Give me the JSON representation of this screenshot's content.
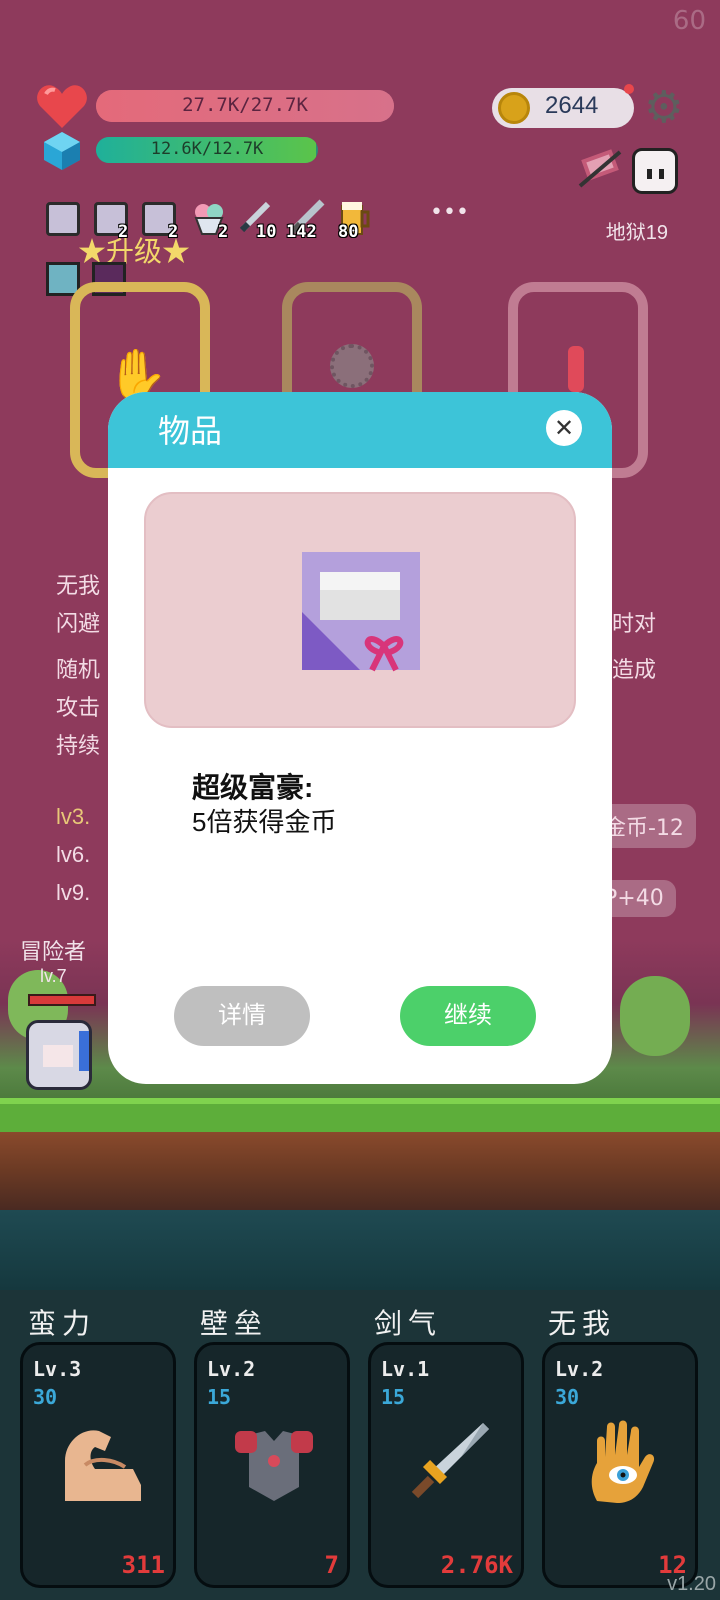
{
  "fps": "60",
  "hp": {
    "text": "27.7K/27.7K",
    "fill": 1.0
  },
  "mana": {
    "text": "12.6K/12.7K",
    "fill": 0.99
  },
  "coins": "2644",
  "stage": "地狱19",
  "buffs": [
    {
      "icon": "gift-scroll-icon",
      "count": ""
    },
    {
      "icon": "gift-scroll-icon",
      "count": "2"
    },
    {
      "icon": "gift-scroll-icon",
      "count": "2"
    },
    {
      "icon": "ice-cream-icon",
      "count": "2"
    },
    {
      "icon": "dagger-icon",
      "count": "10"
    },
    {
      "icon": "sword-icon",
      "count": "142"
    },
    {
      "icon": "beer-icon",
      "count": "80"
    }
  ],
  "more": "•••",
  "upgrade_banner": "★升级★",
  "background_text": {
    "line1": "无我",
    "line2_left": "闪避",
    "line2_right": "时对",
    "line3_left": "随机",
    "line3_right": "造成",
    "line4": "攻击",
    "line5": "持续",
    "lv3": "lv3.",
    "lv6": "lv6.",
    "lv9": "lv9.",
    "chip1": "金币-12",
    "chip2": "P+40"
  },
  "player": {
    "name": "冒险者",
    "level": "lv.7"
  },
  "modal": {
    "title": "物品",
    "item_name": "超级富豪:",
    "item_desc": "5倍获得金币",
    "details_label": "详情",
    "continue_label": "继续"
  },
  "skills": [
    {
      "name": "蛮力",
      "level": "Lv.3",
      "cost": "30",
      "power": "311",
      "icon": "flexed-arm-icon"
    },
    {
      "name": "壁垒",
      "level": "Lv.2",
      "cost": "15",
      "power": "7",
      "icon": "armor-icon"
    },
    {
      "name": "剑气",
      "level": "Lv.1",
      "cost": "15",
      "power": "2.76K",
      "icon": "sword-icon"
    },
    {
      "name": "无我",
      "level": "Lv.2",
      "cost": "30",
      "power": "12",
      "icon": "hand-eye-icon"
    }
  ],
  "version": "v1.20"
}
